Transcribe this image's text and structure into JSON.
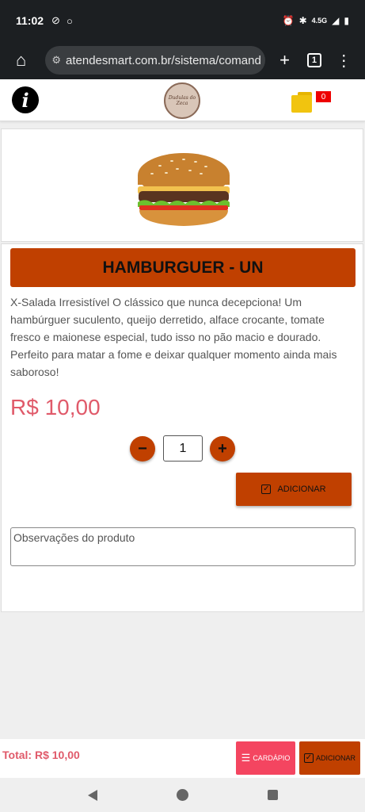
{
  "status_bar": {
    "time": "11:02",
    "network": "4.5G",
    "icons": [
      "do-not-disturb-icon",
      "dot-icon",
      "alarm-icon",
      "bluetooth-icon",
      "signal-icon",
      "battery-icon"
    ]
  },
  "browser": {
    "url": "atendesmart.com.br/sistema/comand",
    "tabs_count": "1",
    "icons": [
      "home-icon",
      "site-settings-icon",
      "new-tab-icon",
      "tabs-icon",
      "more-menu-icon"
    ]
  },
  "header": {
    "logo_text": "Dudulas do Zeca",
    "cart_count": "0",
    "icons": [
      "info-icon",
      "shopping-bags-icon"
    ]
  },
  "product": {
    "title": "HAMBURGUER - UN",
    "description": "X-Salada Irresistível O clássico que nunca decepciona! Um hambúrguer suculento, queijo derretido, alface crocante, tomate fresco e maionese especial, tudo isso no pão macio e dourado. Perfeito para matar a fome e deixar qualquer momento ainda mais saboroso!",
    "price": "R$ 10,00",
    "quantity": "1",
    "minus_label": "−",
    "plus_label": "+",
    "add_label": "ADICIONAR",
    "notes_placeholder": "Observações do produto"
  },
  "footer": {
    "total": "Total: R$ 10,00",
    "menu_label": "CARDÁPIO",
    "add_label": "ADICIONAR"
  },
  "colors": {
    "accent": "#c04000",
    "price": "#e05a6a",
    "menu_button": "#f44560"
  }
}
